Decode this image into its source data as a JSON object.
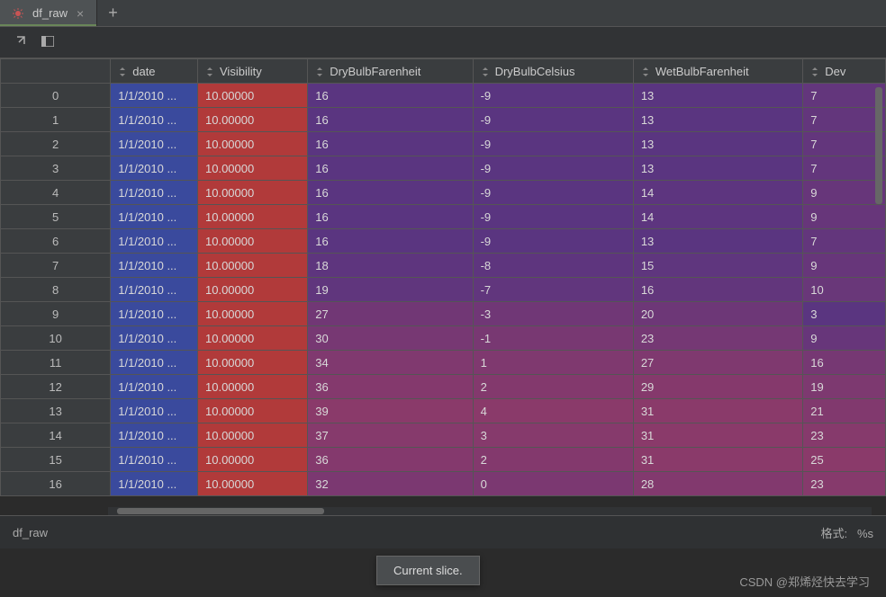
{
  "tab": {
    "title": "df_raw",
    "close": "×",
    "add": "+"
  },
  "toolbar": {
    "popout": "↗",
    "panel": "▭"
  },
  "columns": [
    "date",
    "Visibility",
    "DryBulbFarenheit",
    "DryBulbCelsius",
    "WetBulbFarenheit",
    "Dev"
  ],
  "index_header": "",
  "rows": [
    {
      "idx": "0",
      "date": "1/1/2010 ...",
      "vis": "10.00000",
      "dbf": "16",
      "dbc": "-9",
      "wbf": "13",
      "dev": "7"
    },
    {
      "idx": "1",
      "date": "1/1/2010 ...",
      "vis": "10.00000",
      "dbf": "16",
      "dbc": "-9",
      "wbf": "13",
      "dev": "7"
    },
    {
      "idx": "2",
      "date": "1/1/2010 ...",
      "vis": "10.00000",
      "dbf": "16",
      "dbc": "-9",
      "wbf": "13",
      "dev": "7"
    },
    {
      "idx": "3",
      "date": "1/1/2010 ...",
      "vis": "10.00000",
      "dbf": "16",
      "dbc": "-9",
      "wbf": "13",
      "dev": "7"
    },
    {
      "idx": "4",
      "date": "1/1/2010 ...",
      "vis": "10.00000",
      "dbf": "16",
      "dbc": "-9",
      "wbf": "14",
      "dev": "9"
    },
    {
      "idx": "5",
      "date": "1/1/2010 ...",
      "vis": "10.00000",
      "dbf": "16",
      "dbc": "-9",
      "wbf": "14",
      "dev": "9"
    },
    {
      "idx": "6",
      "date": "1/1/2010 ...",
      "vis": "10.00000",
      "dbf": "16",
      "dbc": "-9",
      "wbf": "13",
      "dev": "7"
    },
    {
      "idx": "7",
      "date": "1/1/2010 ...",
      "vis": "10.00000",
      "dbf": "18",
      "dbc": "-8",
      "wbf": "15",
      "dev": "9"
    },
    {
      "idx": "8",
      "date": "1/1/2010 ...",
      "vis": "10.00000",
      "dbf": "19",
      "dbc": "-7",
      "wbf": "16",
      "dev": "10"
    },
    {
      "idx": "9",
      "date": "1/1/2010 ...",
      "vis": "10.00000",
      "dbf": "27",
      "dbc": "-3",
      "wbf": "20",
      "dev": "3"
    },
    {
      "idx": "10",
      "date": "1/1/2010 ...",
      "vis": "10.00000",
      "dbf": "30",
      "dbc": "-1",
      "wbf": "23",
      "dev": "9"
    },
    {
      "idx": "11",
      "date": "1/1/2010 ...",
      "vis": "10.00000",
      "dbf": "34",
      "dbc": "1",
      "wbf": "27",
      "dev": "16"
    },
    {
      "idx": "12",
      "date": "1/1/2010 ...",
      "vis": "10.00000",
      "dbf": "36",
      "dbc": "2",
      "wbf": "29",
      "dev": "19"
    },
    {
      "idx": "13",
      "date": "1/1/2010 ...",
      "vis": "10.00000",
      "dbf": "39",
      "dbc": "4",
      "wbf": "31",
      "dev": "21"
    },
    {
      "idx": "14",
      "date": "1/1/2010 ...",
      "vis": "10.00000",
      "dbf": "37",
      "dbc": "3",
      "wbf": "31",
      "dev": "23"
    },
    {
      "idx": "15",
      "date": "1/1/2010 ...",
      "vis": "10.00000",
      "dbf": "36",
      "dbc": "2",
      "wbf": "31",
      "dev": "25"
    },
    {
      "idx": "16",
      "date": "1/1/2010 ...",
      "vis": "10.00000",
      "dbf": "32",
      "dbc": "0",
      "wbf": "28",
      "dev": "23"
    }
  ],
  "gradient": {
    "dbf": {
      "min": 16,
      "max": 39,
      "c0": "#5a3580",
      "c1": "#8a3a6a"
    },
    "dbc": {
      "min": -9,
      "max": 4,
      "c0": "#5a3580",
      "c1": "#8a3a6a"
    },
    "wbf": {
      "min": 13,
      "max": 31,
      "c0": "#5a3580",
      "c1": "#8a3a6a"
    },
    "dev": {
      "min": 3,
      "max": 25,
      "c0": "#5a3580",
      "c1": "#8a3a6a"
    }
  },
  "footer": {
    "name": "df_raw",
    "format_label": "格式:",
    "format_value": "%s"
  },
  "tooltip": "Current slice.",
  "watermark": "CSDN @郑烯烃快去学习"
}
